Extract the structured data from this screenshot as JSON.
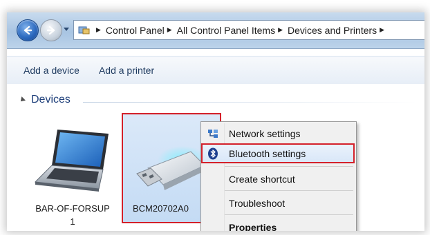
{
  "address_bar": {
    "breadcrumbs": [
      "Control Panel",
      "All Control Panel Items",
      "Devices and Printers"
    ],
    "icon": "control-panel-icon"
  },
  "toolbar": {
    "add_device_label": "Add a device",
    "add_printer_label": "Add a printer"
  },
  "devices_group": {
    "title": "Devices",
    "items": [
      {
        "name_line1": "BAR-OF-FORSUP",
        "name_line2": "1",
        "icon": "laptop-icon"
      },
      {
        "name_line1": "BCM20702A0",
        "icon": "usb-bluetooth-dongle-icon",
        "highlighted": true
      }
    ]
  },
  "context_menu": {
    "items": [
      {
        "label": "Network settings",
        "icon": "network-settings-icon"
      },
      {
        "label": "Bluetooth settings",
        "icon": "bluetooth-icon",
        "highlighted": true
      },
      {
        "label": "Create shortcut"
      },
      {
        "label": "Troubleshoot"
      },
      {
        "label": "Properties",
        "bold": true
      }
    ]
  },
  "colors": {
    "highlight_border": "#d4202a",
    "link_text": "#1e3f7a",
    "selection_fill": "#c4dbf4"
  }
}
